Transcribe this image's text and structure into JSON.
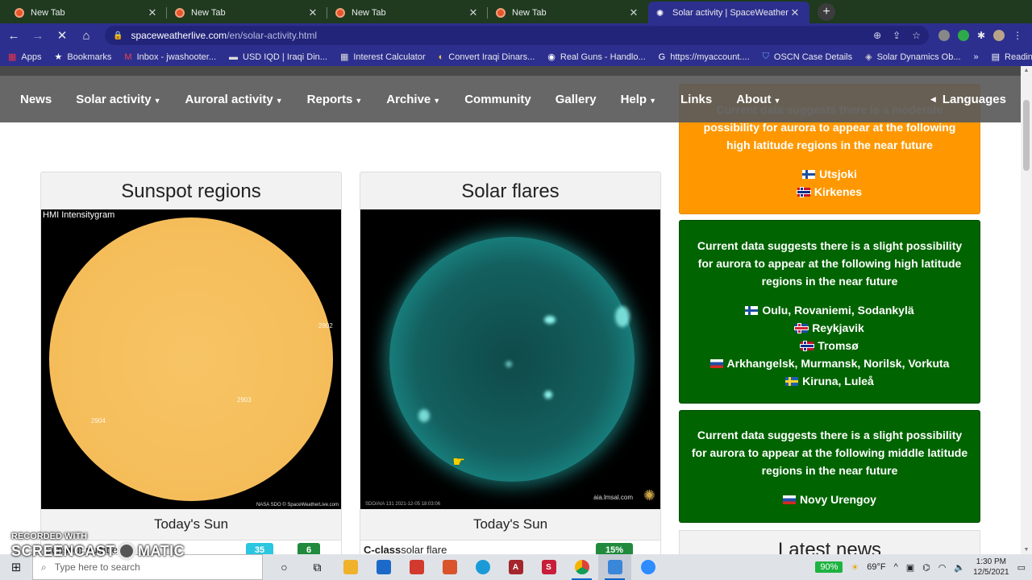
{
  "browser": {
    "tabs": [
      {
        "label": "New Tab",
        "close": "✕"
      },
      {
        "label": "New Tab",
        "close": "✕"
      },
      {
        "label": "New Tab",
        "close": "✕"
      },
      {
        "label": "New Tab",
        "close": "✕"
      },
      {
        "label": "Solar activity | SpaceWeatherLive",
        "close": "✕"
      }
    ],
    "new_tab": "+",
    "url_host": "spaceweatherlive.com",
    "url_path": "/en/solar-activity.html",
    "bookmarks": [
      {
        "label": "Apps",
        "icon": "apps-grid-icon"
      },
      {
        "label": "Bookmarks",
        "icon": "star-icon"
      },
      {
        "label": "Inbox - jwashooter...",
        "icon": "gmail-icon"
      },
      {
        "label": "USD IQD | Iraqi Din...",
        "icon": "currency-icon"
      },
      {
        "label": "Interest Calculator",
        "icon": "calculator-icon"
      },
      {
        "label": "Convert Iraqi Dinars...",
        "icon": "convert-icon"
      },
      {
        "label": "Real Guns - Handlo...",
        "icon": "globe-icon"
      },
      {
        "label": "https://myaccount....",
        "icon": "google-icon"
      },
      {
        "label": "OSCN Case Details",
        "icon": "shield-icon"
      },
      {
        "label": "Solar Dynamics Ob...",
        "icon": "sdo-icon"
      }
    ],
    "bookmarks_more": "»",
    "reading_list": "Reading list"
  },
  "site_nav": {
    "items": [
      {
        "label": "News",
        "dropdown": false
      },
      {
        "label": "Solar activity",
        "dropdown": true
      },
      {
        "label": "Auroral activity",
        "dropdown": true
      },
      {
        "label": "Reports",
        "dropdown": true
      },
      {
        "label": "Archive",
        "dropdown": true
      },
      {
        "label": "Community",
        "dropdown": false
      },
      {
        "label": "Gallery",
        "dropdown": false
      },
      {
        "label": "Help",
        "dropdown": true
      },
      {
        "label": "Links",
        "dropdown": false
      },
      {
        "label": "About",
        "dropdown": true
      }
    ],
    "languages": "Languages"
  },
  "sunspot_card": {
    "title": "Sunspot regions",
    "image_label": "HMI Intensitygram",
    "regions": [
      "2902",
      "2903",
      "2904"
    ],
    "credit": "NASA SDO © SpaceWeatherLive.com",
    "caption": "Today's Sun",
    "sub_label": "Sunspot number",
    "pill1": "35",
    "pill2": "6"
  },
  "flares_card": {
    "title": "Solar flares",
    "credit": "aia.lmsal.com",
    "timestamp": "SDO/AIA 131 2021-12-05 18:03:06",
    "caption": "Today's Sun",
    "sub_label_bold": "C-class",
    "sub_label_rest": " solar flare",
    "pill": "15%"
  },
  "aurora": [
    {
      "color": "#ff9800",
      "message": "Current data suggests there is a moderate possibility for aurora to appear at the following high latitude regions in the near future",
      "locations": [
        {
          "flag": "fi",
          "text": "Utsjoki"
        },
        {
          "flag": "no",
          "text": "Kirkenes"
        }
      ]
    },
    {
      "color": "#006400",
      "message": "Current data suggests there is a slight possibility for aurora to appear at the following high latitude regions in the near future",
      "locations": [
        {
          "flag": "fi",
          "text": "Oulu, Rovaniemi, Sodankylä"
        },
        {
          "flag": "is",
          "text": "Reykjavik"
        },
        {
          "flag": "no",
          "text": "Tromsø"
        },
        {
          "flag": "ru",
          "text": "Arkhangelsk, Murmansk, Norilsk, Vorkuta"
        },
        {
          "flag": "se",
          "text": "Kiruna, Luleå"
        }
      ]
    },
    {
      "color": "#006400",
      "message": "Current data suggests there is a slight possibility for aurora to appear at the following middle latitude regions in the near future",
      "locations": [
        {
          "flag": "ru",
          "text": "Novy Urengoy"
        }
      ]
    }
  ],
  "latest_news": "Latest news",
  "watermark": {
    "recorded": "RECORDED WITH",
    "brand_a": "SCREENCAST",
    "brand_b": "MATIC"
  },
  "taskbar": {
    "search_placeholder": "Type here to search",
    "battery": "90%",
    "weather": "69°F",
    "time": "1:30 PM",
    "date": "12/5/2021"
  }
}
